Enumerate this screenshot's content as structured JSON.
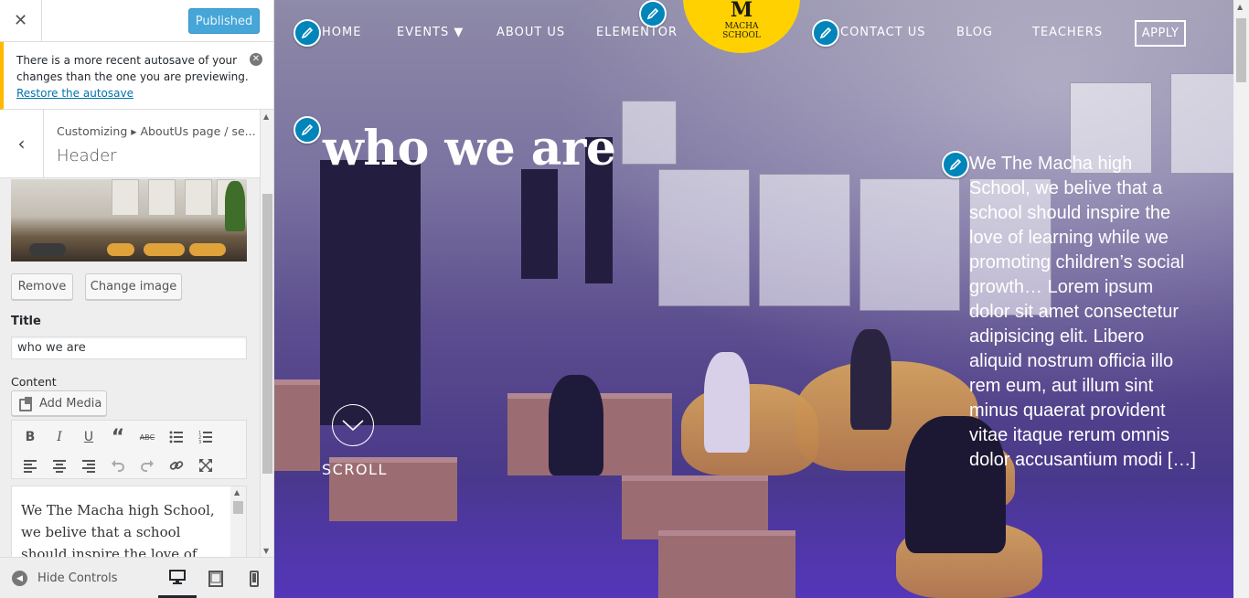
{
  "customizer": {
    "close_glyph": "✕",
    "publish_label": "Published",
    "autosave": {
      "message": "There is a more recent autosave of your changes than the one you are previewing.",
      "link": "Restore the autosave"
    },
    "back_glyph": "‹",
    "breadcrumb": "Customizing ▸ AboutUs page / se...",
    "section_title": "Header",
    "buttons": {
      "remove": "Remove",
      "change_image": "Change image",
      "add_media": "Add Media"
    },
    "title_label": "Title",
    "title_value": "who we are",
    "content_label": "Content",
    "editor_text": "We The Macha high School, we belive that a school should inspire the love of learning",
    "toolbar_icons": [
      "bold-icon",
      "italic-icon",
      "underline-icon",
      "blockquote-icon",
      "strikethrough-icon",
      "bullet-list-icon",
      "numbered-list-icon",
      "align-left-icon",
      "align-center-icon",
      "align-right-icon",
      "undo-icon",
      "redo-icon",
      "link-icon",
      "fullscreen-icon"
    ],
    "footer": {
      "hide_controls": "Hide Controls",
      "devices": [
        "desktop-icon",
        "tablet-icon",
        "mobile-icon"
      ]
    }
  },
  "site": {
    "nav": {
      "home": "HOME",
      "events": "EVENTS ▼",
      "about": "ABOUT US",
      "elementor": "ELEMENTOR",
      "contact": "CONTACT US",
      "blog": "BLOG",
      "teachers": "TEACHERS",
      "apply": "APPLY"
    },
    "logo": {
      "letter": "M",
      "line1": "MACHA",
      "line2": "SCHOOL",
      "color": "#ffd100"
    },
    "hero": {
      "title": "who we are",
      "text": "We The Macha high School, we belive that a school should inspire the love of learning while we promoting children’s social growth… Lorem ipsum dolor sit amet consectetur adipisicing elit. Libero aliquid nostrum officia illo rem eum, aut illum sint minus quaerat provident vitae itaque rerum omnis dolor accusantium modi […]",
      "scroll_label": "SCROLL"
    }
  },
  "colors": {
    "publish": "#46a6d8",
    "notice": "#ffb900",
    "edit_shortcut": "#0085ba",
    "overlay": "#4b36a3"
  }
}
